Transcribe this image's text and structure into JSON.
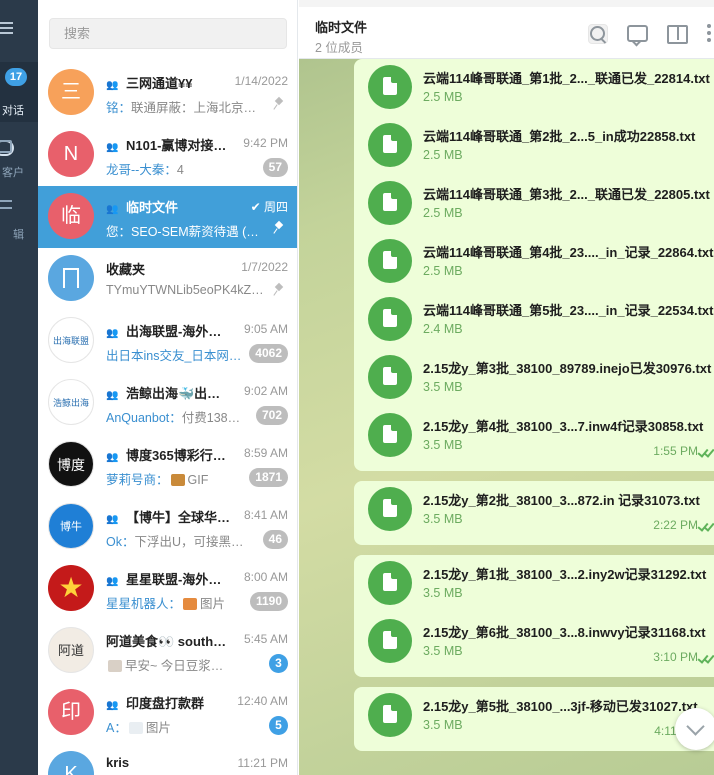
{
  "rail": {
    "unread_badge": "17",
    "tabs": [
      {
        "label": "对话",
        "icon": "chat-bubble-icon",
        "active": true
      },
      {
        "label": "客户",
        "icon": "folder-icon",
        "active": false
      },
      {
        "label": "辑",
        "icon": "edit-sliders-icon",
        "active": false
      }
    ]
  },
  "search": {
    "placeholder": "搜索"
  },
  "chats": [
    {
      "avatar_text": "三",
      "avatar_color": "#f7a15a",
      "group": true,
      "name": "三网通道¥¥",
      "time": "1/14/2022",
      "who": "铭：",
      "preview": "联通屏蔽：上海北京…",
      "pinned": true,
      "count": ""
    },
    {
      "avatar_text": "N",
      "avatar_color": "#e8606b",
      "group": true,
      "name": "N101-赢博对接…",
      "time": "9:42 PM",
      "who": "龙哥--大秦：",
      "preview": "4",
      "pinned": false,
      "count": "57"
    },
    {
      "avatar_text": "临",
      "avatar_color": "#e8606b",
      "group": true,
      "name": "临时文件",
      "time": "✔ 周四",
      "who": "您：",
      "preview": "SEO-SEM薪资待遇 (…",
      "pinned": true,
      "count": "",
      "active": true
    },
    {
      "avatar_text": "",
      "avatar_color": "#5aa7e0",
      "group": false,
      "name": "收藏夹",
      "time": "1/7/2022",
      "who": "",
      "preview": "TYmuYTWNLib5eoPK4kZ…",
      "pinned": true,
      "count": ""
    },
    {
      "avatar_text": "出海联盟",
      "avatar_color": "#ffffff",
      "group": true,
      "name": "出海联盟-海外资…",
      "time": "9:05 AM",
      "who": "出日本ins交友_日本网…",
      "preview": "",
      "pinned": false,
      "count": "4062"
    },
    {
      "avatar_text": "浩鲸出海",
      "avatar_color": "#ffffff",
      "group": true,
      "name": "浩鲸出海🐳出…",
      "time": "9:02 AM",
      "who": "AnQuanbot：",
      "preview": "付费138…",
      "pinned": false,
      "count": "702"
    },
    {
      "avatar_text": "博度",
      "avatar_color": "#111111",
      "group": true,
      "name": "博度365博彩行…",
      "time": "8:59 AM",
      "who": "萝莉号商：",
      "preview": "GIF",
      "pinned": false,
      "count": "1871",
      "thumb": "#c98a3a"
    },
    {
      "avatar_text": "博牛",
      "avatar_color": "#1f7fd6",
      "group": true,
      "name": "【博牛】全球华人…",
      "time": "8:41 AM",
      "who": "Ok：",
      "preview": "下浮出U，可接黑…",
      "pinned": false,
      "count": "46"
    },
    {
      "avatar_text": "★",
      "avatar_color": "#c41a1a",
      "group": true,
      "name": "星星联盟-海外资…",
      "time": "8:00 AM",
      "who": "星星机器人：",
      "preview": "图片",
      "pinned": false,
      "count": "1190",
      "thumb": "#e58b3f"
    },
    {
      "avatar_text": "阿道",
      "avatar_color": "#f2ece4",
      "group": false,
      "name": "阿道美食👀 south…",
      "time": "5:45 AM",
      "who": "",
      "preview": "早安~ 今日豆浆…",
      "pinned": false,
      "count": "3",
      "count_blue": true,
      "thumb": "#d9d0c6"
    },
    {
      "avatar_text": "印",
      "avatar_color": "#e8606b",
      "group": true,
      "name": "印度盘打款群",
      "time": "12:40 AM",
      "who": "A：",
      "preview": "图片",
      "pinned": false,
      "count": "5",
      "count_blue": true,
      "thumb": "#e9eef2"
    },
    {
      "avatar_text": "K",
      "avatar_color": "#5aa7e0",
      "group": false,
      "name": "kris",
      "time": "11:21 PM",
      "who": "",
      "preview": "",
      "pinned": false,
      "count": ""
    }
  ],
  "header": {
    "title": "临时文件",
    "subtitle": "2 位成员"
  },
  "messages": [
    {
      "name": "云端114峰哥联通_第1批_2..._联通已发_22814.txt",
      "size": "2.5 MB",
      "time": "",
      "shape": "top"
    },
    {
      "name": "云端114峰哥联通_第2批_2...5_in成功22858.txt",
      "size": "2.5 MB",
      "time": "",
      "shape": "mid"
    },
    {
      "name": "云端114峰哥联通_第3批_2..._联通已发_22805.txt",
      "size": "2.5 MB",
      "time": "",
      "shape": "mid"
    },
    {
      "name": "云端114峰哥联通_第4批_23...._in_记录_22864.txt",
      "size": "2.5 MB",
      "time": "",
      "shape": "mid"
    },
    {
      "name": "云端114峰哥联通_第5批_23...._in_记录_22534.txt",
      "size": "2.4 MB",
      "time": "",
      "shape": "mid"
    },
    {
      "name": "2.15龙y_第3批_38100_89789.inejo已发30976.txt",
      "size": "3.5 MB",
      "time": "",
      "shape": "mid"
    },
    {
      "name": "2.15龙y_第4批_38100_3...7.inw4f记录30858.txt",
      "size": "3.5 MB",
      "time": "1:55 PM",
      "shape": "bottom"
    },
    {
      "name": "2.15龙y_第2批_38100_3...872.in 记录31073.txt",
      "size": "3.5 MB",
      "time": "2:22 PM",
      "shape": "single"
    },
    {
      "name": "2.15龙y_第1批_38100_3...2.iny2w记录31292.txt",
      "size": "3.5 MB",
      "time": "",
      "shape": "top"
    },
    {
      "name": "2.15龙y_第6批_38100_3...8.inwvy记录31168.txt",
      "size": "3.5 MB",
      "time": "3:10 PM",
      "shape": "bottom"
    },
    {
      "name": "2.15龙y_第5批_38100_...3jf-移动已发31027.txt",
      "size": "3.5 MB",
      "time": "4:11 PM",
      "shape": "single"
    }
  ]
}
